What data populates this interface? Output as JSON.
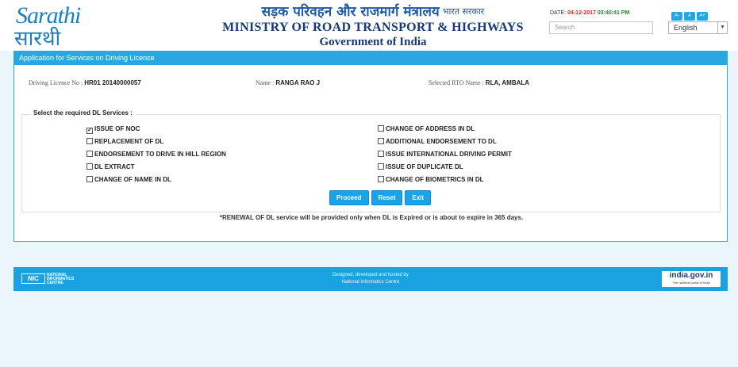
{
  "header": {
    "logo_en": "Sarathi",
    "logo_hi": "सारथी",
    "title_hindi": "सड़क परिवहन और राजमार्ग मंत्रालय",
    "title_hindi_small": "भारत सरकार",
    "ministry": "MINISTRY OF ROAD TRANSPORT & HIGHWAYS",
    "government": "Government of India",
    "date_label": "DATE:",
    "date": "04-12-2017",
    "time": "03:40:41 PM",
    "search_placeholder": "Search",
    "font_buttons": [
      "A-",
      "A",
      "A+"
    ],
    "language": "English"
  },
  "panel": {
    "title": "Application for Services on Driving Licence",
    "dl_label": "Driving Licence No :",
    "dl_value": "HR01 20140000057",
    "name_label": "Name :",
    "name_value": "RANGA RAO J",
    "rto_label": "Selected RTO Name :",
    "rto_value": "RLA, AMBALA",
    "legend": "Select the required DL Services :",
    "services_left": [
      {
        "label": "ISSUE OF NOC",
        "checked": true
      },
      {
        "label": "REPLACEMENT OF DL",
        "checked": false
      },
      {
        "label": "ENDORSEMENT TO DRIVE IN HILL REGION",
        "checked": false
      },
      {
        "label": "DL EXTRACT",
        "checked": false
      },
      {
        "label": "CHANGE OF NAME IN DL",
        "checked": false
      }
    ],
    "services_right": [
      {
        "label": "CHANGE OF ADDRESS IN DL",
        "checked": false
      },
      {
        "label": "ADDITIONAL ENDORSEMENT TO DL",
        "checked": false
      },
      {
        "label": "ISSUE INTERNATIONAL DRIVING PERMIT",
        "checked": false
      },
      {
        "label": "ISSUE OF DUPLICATE DL",
        "checked": false
      },
      {
        "label": "CHANGE OF BIOMETRICS IN DL",
        "checked": false
      }
    ],
    "buttons": {
      "proceed": "Proceed",
      "reset": "Reset",
      "exit": "Exit"
    },
    "note": "*RENEWAL OF DL service will be provided only when DL is Expired or is about to expire in 365 days."
  },
  "footer": {
    "nic_abbr": "NIC",
    "nic_line1": "NATIONAL",
    "nic_line2": "INFORMATICS",
    "nic_line3": "CENTRE",
    "credit_line1": "Designed, developed and hosted by",
    "credit_line2": "National Informatics Centre",
    "india_gov": "india.gov.in",
    "india_gov_sub": "The national portal of India"
  }
}
